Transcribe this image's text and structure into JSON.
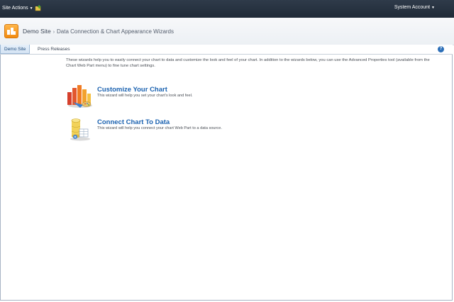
{
  "ribbon": {
    "site_actions_label": "Site Actions",
    "account_label": "System Account",
    "navigate_up_icon": "navigate-up-icon"
  },
  "title_area": {
    "site_name": "Demo Site",
    "separator": "›",
    "page_title": "Data Connection & Chart Appearance Wizards"
  },
  "topnav": {
    "tabs": [
      {
        "label": "Demo Site",
        "active": true
      },
      {
        "label": "Press Releases",
        "active": false
      }
    ],
    "help_icon": "help-icon"
  },
  "content": {
    "intro": "These wizards help you to easily connect your chart to data and customize the look and feel of your chart. In addition to the wizards below, you can use the Advanced Properties tool (available from the Chart Web Part menu) to fine tune chart settings.",
    "wizards": [
      {
        "title": "Customize Your Chart",
        "description": "This wizard will help you set your chart's look and feel.",
        "icon": "chart-appearance-icon"
      },
      {
        "title": "Connect Chart To Data",
        "description": "This wizard will help you connect your chart Web Part to a data source.",
        "icon": "data-connection-icon"
      }
    ]
  },
  "colors": {
    "ribbon_bg": "#24303e",
    "link_blue": "#1b62b0",
    "active_tab": "#d4e4f4"
  }
}
